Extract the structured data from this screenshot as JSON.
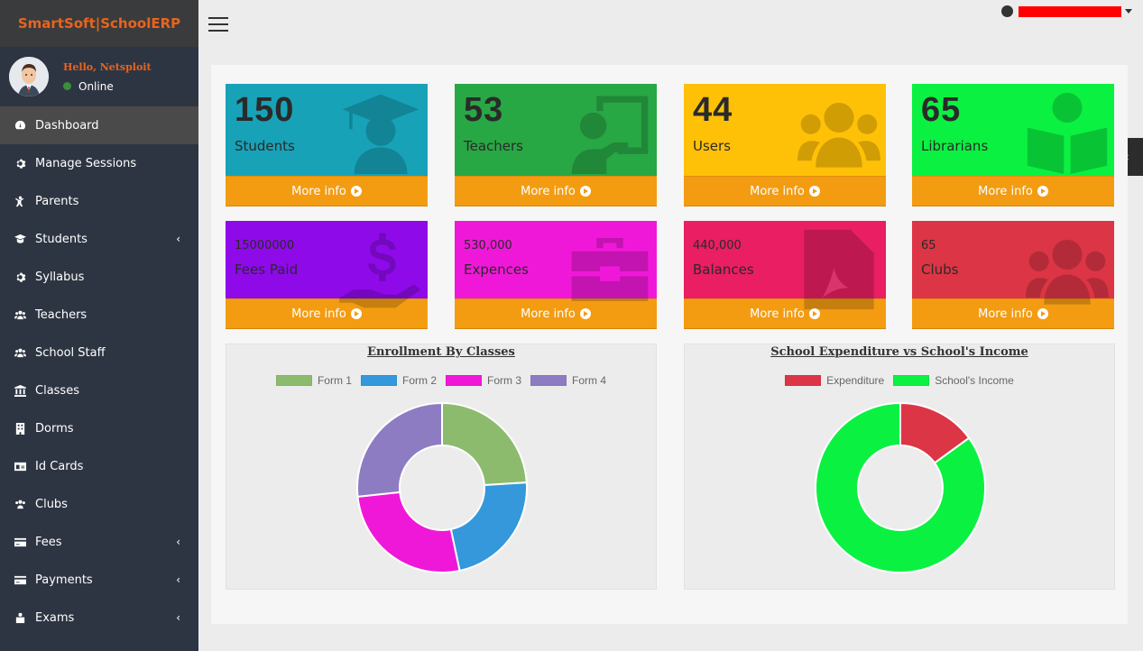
{
  "brand": "SmartSoft|SchoolERP",
  "user": {
    "hello": "Hello, Netsploit",
    "status": "Online"
  },
  "sidebar": {
    "items": [
      {
        "label": "Dashboard",
        "icon": "dashboard-icon",
        "active": true,
        "chevron": false
      },
      {
        "label": "Manage Sessions",
        "icon": "gear-icon",
        "chevron": false
      },
      {
        "label": "Parents",
        "icon": "child-icon",
        "chevron": false
      },
      {
        "label": "Students",
        "icon": "student-icon",
        "chevron": true
      },
      {
        "label": "Syllabus",
        "icon": "gear-icon",
        "chevron": false
      },
      {
        "label": "Teachers",
        "icon": "users-icon",
        "chevron": false
      },
      {
        "label": "School Staff",
        "icon": "users-icon",
        "chevron": false
      },
      {
        "label": "Classes",
        "icon": "bank-icon",
        "chevron": false
      },
      {
        "label": "Dorms",
        "icon": "building-icon",
        "chevron": false
      },
      {
        "label": "Id Cards",
        "icon": "id-card-icon",
        "chevron": false
      },
      {
        "label": "Clubs",
        "icon": "users-group-icon",
        "chevron": false
      },
      {
        "label": "Fees",
        "icon": "credit-card-icon",
        "chevron": true
      },
      {
        "label": "Payments",
        "icon": "credit-card-icon",
        "chevron": true
      },
      {
        "label": "Exams",
        "icon": "exam-icon",
        "chevron": true
      }
    ],
    "chevron_glyph": "‹"
  },
  "stats_large": [
    {
      "value": "150",
      "label": "Students",
      "color": "#17a2b8",
      "icon": "graduate-icon",
      "more": "More info"
    },
    {
      "value": "53",
      "label": "Teachers",
      "color": "#28a745",
      "icon": "chalkboard-teacher-icon",
      "more": "More info"
    },
    {
      "value": "44",
      "label": "Users",
      "color": "#ffc107",
      "icon": "users-icon",
      "more": "More info"
    },
    {
      "value": "65",
      "label": "Librarians",
      "color": "#0bf142",
      "icon": "book-reader-icon",
      "more": "More info"
    }
  ],
  "stats_small": [
    {
      "value": "15000000",
      "label": "Fees Paid",
      "color": "#8e0ae8",
      "icon": "hand-dollar-icon",
      "more": "More info"
    },
    {
      "value": "530,000",
      "label": "Expences",
      "color": "#f018d8",
      "icon": "toolbox-icon",
      "more": "More info"
    },
    {
      "value": "440,000",
      "label": "Balances",
      "color": "#e91e63",
      "icon": "pdf-file-icon",
      "more": "More info"
    },
    {
      "value": "65",
      "label": "Clubs",
      "color": "#dc3545",
      "icon": "users-icon",
      "more": "More info"
    }
  ],
  "chart_data": [
    {
      "type": "pie",
      "title": "Enrollment By Classes",
      "categories": [
        "Form 1",
        "Form 2",
        "Form 3",
        "Form 4"
      ],
      "values": [
        36,
        34,
        40,
        40
      ],
      "colors": [
        "#8cbb6d",
        "#3498db",
        "#f018d8",
        "#8e7cc3"
      ],
      "legend": "top"
    },
    {
      "type": "pie",
      "title": "School Expenditure vs School's Income",
      "categories": [
        "Expenditure",
        "School's Income"
      ],
      "values": [
        530000,
        3000000
      ],
      "colors": [
        "#dc3545",
        "#0bf142"
      ],
      "legend": "top"
    }
  ]
}
